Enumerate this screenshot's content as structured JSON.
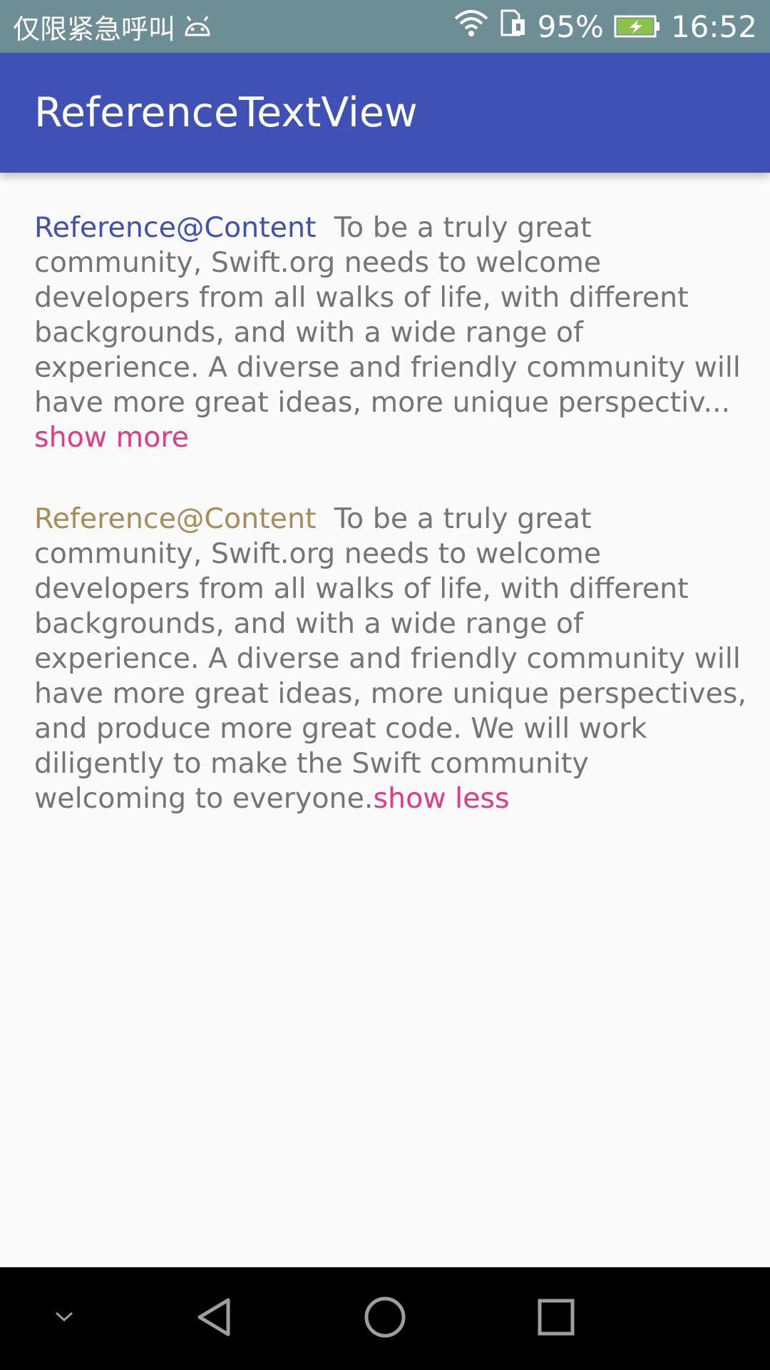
{
  "status_bar": {
    "carrier_text": "仅限紧急呼叫",
    "battery_percent": "95%",
    "time": "16:52",
    "icons": [
      "android-icon",
      "wifi-icon",
      "sim-icon",
      "battery-charging-icon"
    ]
  },
  "app_bar": {
    "title": "ReferenceTextView",
    "color": "#3F51B5"
  },
  "items": [
    {
      "reference": "Reference@Content",
      "reference_color": "#3F51B5",
      "content": "To be a truly great community, Swift.org needs to welcome developers from all walks of life, with different backgrounds, and with a wide range of experience. A diverse and friendly community will have more great ideas, more unique perspectiv...",
      "toggle_label": "show more",
      "expanded": false
    },
    {
      "reference": "Reference@Content",
      "reference_color": "#A68D58",
      "content": "To be a truly great community, Swift.org needs to welcome developers from all walks of life, with different backgrounds, and with a wide range of experience. A diverse and friendly community will have more great ideas, more unique perspectives, and produce more great code. We will work diligently to make the Swift community welcoming to everyone.",
      "toggle_label": "show less",
      "expanded": true
    }
  ],
  "toggle_color": "#E6397F",
  "nav_bar": {
    "buttons": [
      "collapse-icon",
      "back-icon",
      "home-icon",
      "recents-icon"
    ]
  }
}
